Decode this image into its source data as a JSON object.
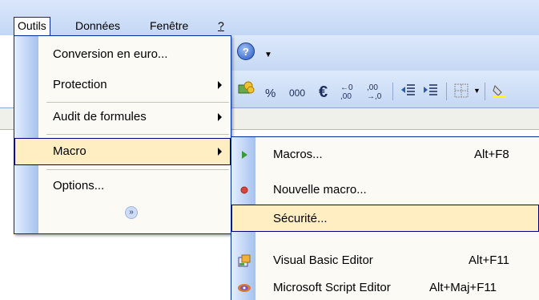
{
  "menubar": {
    "items": [
      {
        "label": "Outils",
        "active": true
      },
      {
        "label": "Données",
        "active": false
      },
      {
        "label": "Fenêtre",
        "active": false
      },
      {
        "label": "?",
        "active": false
      }
    ]
  },
  "toolbar": {
    "percent": "%",
    "thousands": "000",
    "euro": "€",
    "dec_increase": "←0 ,00",
    "dec_decrease": ",00 →,0"
  },
  "outils_menu": {
    "items": [
      {
        "label": "Conversion en euro...",
        "has_submenu": false
      },
      {
        "label": "Protection",
        "has_submenu": true
      },
      {
        "label": "Audit de formules",
        "has_submenu": true
      },
      {
        "label": "Macro",
        "has_submenu": true,
        "highlighted": true
      },
      {
        "label": "Options...",
        "has_submenu": false
      }
    ],
    "expand_icon": "chevron-double-down-icon"
  },
  "macro_submenu": {
    "items": [
      {
        "label": "Macros...",
        "shortcut": "Alt+F8",
        "icon": "play-icon"
      },
      {
        "label": "Nouvelle macro...",
        "shortcut": "",
        "icon": "record-icon"
      },
      {
        "label": "Sécurité...",
        "shortcut": "",
        "icon": "",
        "highlighted": true
      },
      {
        "label": "Visual Basic Editor",
        "shortcut": "Alt+F11",
        "icon": "vb-editor-icon"
      },
      {
        "label": "Microsoft Script Editor",
        "shortcut": "Alt+Maj+F11",
        "icon": "script-editor-icon"
      }
    ]
  },
  "colors": {
    "menu_highlight": "#ffeec2",
    "menu_border": "#002d96",
    "gutter": "#a6c1ee"
  }
}
